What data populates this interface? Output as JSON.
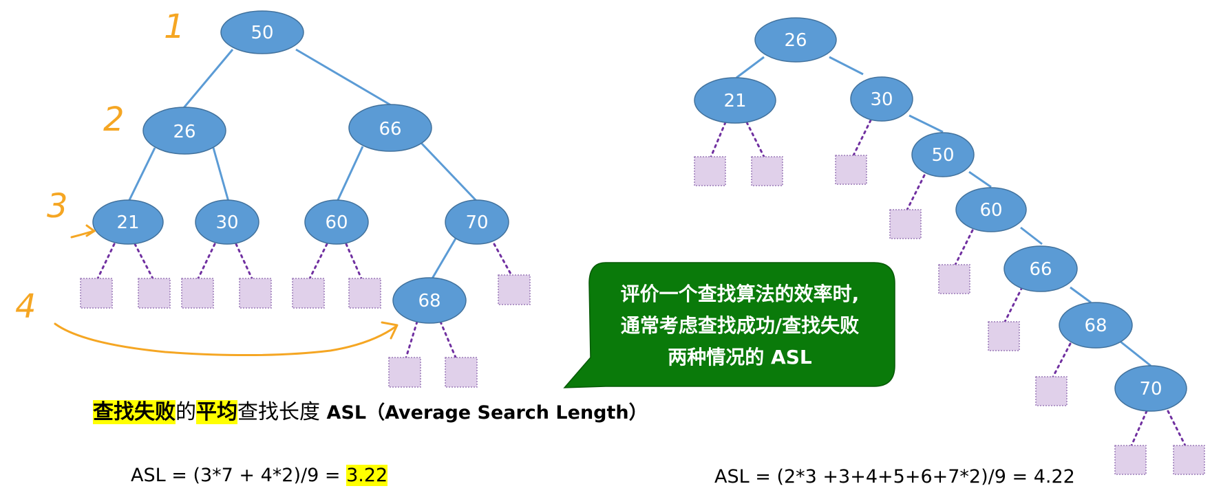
{
  "left_tree": {
    "levels": [
      "1",
      "2",
      "3",
      "4"
    ],
    "nodes": [
      "50",
      "26",
      "66",
      "21",
      "30",
      "60",
      "70",
      "68"
    ]
  },
  "right_tree": {
    "nodes": [
      "26",
      "21",
      "30",
      "50",
      "60",
      "66",
      "68",
      "70"
    ]
  },
  "callout": {
    "line1": "评价一个查找算法的效率时,",
    "line2": "通常考虑查找成功/查找失败",
    "line3": "两种情况的 ASL"
  },
  "caption": {
    "part1": "查找失败",
    "part2": "的",
    "part3": "平均",
    "part4": "查找长度 ",
    "part5": "ASL（Average Search Length）"
  },
  "formula_left": {
    "prefix": "ASL = (3*7 + 4*2)/9 = ",
    "result": "3.22"
  },
  "formula_right": {
    "text": "ASL = (2*3 +3+4+5+6+7*2)/9 = 4.22"
  },
  "colors": {
    "node_fill": "#5b9bd5",
    "node_stroke": "#41719c",
    "edge": "#5b9bd5",
    "failure_box_fill": "#e0d0ea",
    "failure_box_stroke": "#9b7bb8",
    "failure_edge": "#7030a0",
    "callout_fill": "#0a7a0a",
    "annotation": "#f5a623",
    "highlight": "#ffff00"
  }
}
